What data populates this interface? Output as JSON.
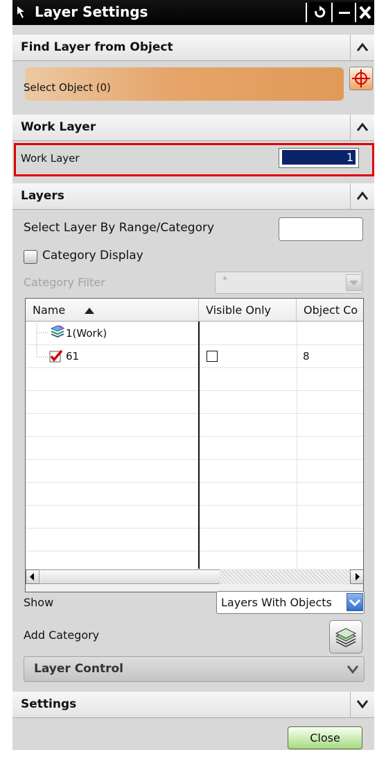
{
  "window": {
    "title": "Layer Settings"
  },
  "sections": {
    "find_layer": "Find Layer from Object",
    "work_layer": "Work Layer",
    "layers": "Layers",
    "settings": "Settings"
  },
  "find_layer": {
    "select_object_label": "Select Object (0)"
  },
  "work_layer": {
    "label": "Work Layer",
    "value": "1"
  },
  "layers": {
    "select_by_range_label": "Select Layer By Range/Category",
    "select_by_range_value": "",
    "category_display_label": "Category Display",
    "category_display_checked": false,
    "category_filter_label": "Category Filter",
    "category_filter_value": "*",
    "grid": {
      "columns": [
        "Name",
        "Visible Only",
        "Object Co"
      ],
      "sort_column": "Name",
      "rows": [
        {
          "name": "1(Work)",
          "icon": "work-layer-icon",
          "visible_only": "",
          "object_count": ""
        },
        {
          "name": "61",
          "icon": "checked-checkbox-icon",
          "visible_only": "unchecked",
          "object_count": "8"
        }
      ]
    },
    "show_label": "Show",
    "show_value": "Layers With Objects",
    "add_category_label": "Add Category",
    "layer_control_label": "Layer Control"
  },
  "footer": {
    "close_label": "Close"
  },
  "colors": {
    "title_bg": "#000000",
    "select_bar": "#e6a56a",
    "highlight_border": "#e00000",
    "selection_bg": "#0a246a",
    "close_button": "#a7db7f"
  }
}
